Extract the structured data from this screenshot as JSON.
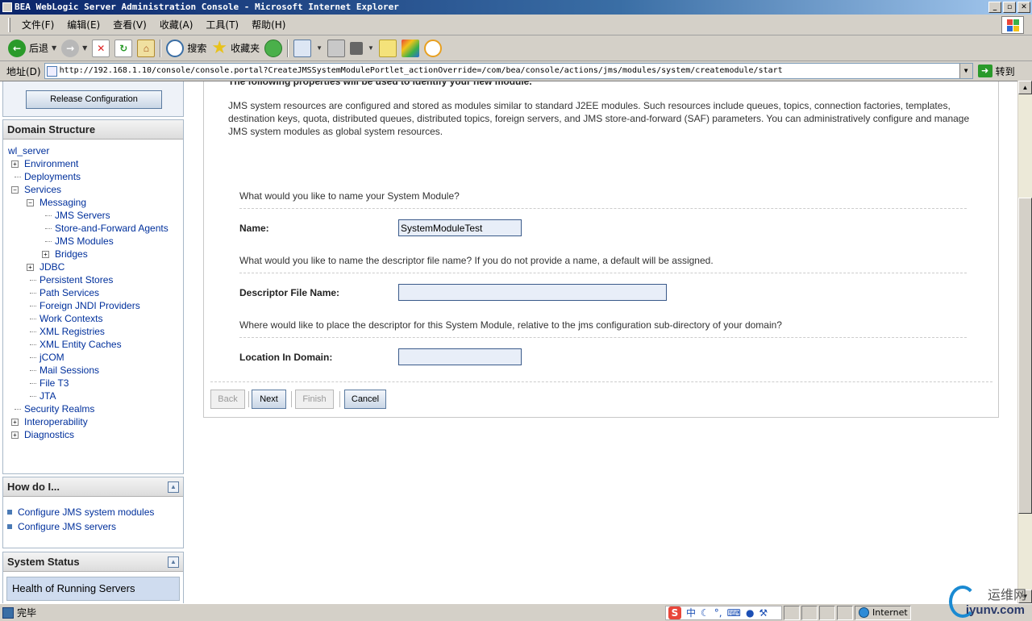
{
  "window": {
    "title": "BEA WebLogic Server Administration Console - Microsoft Internet Explorer",
    "buttons": [
      "_",
      "▫",
      "✕"
    ]
  },
  "menu": [
    "文件(F)",
    "编辑(E)",
    "查看(V)",
    "收藏(A)",
    "工具(T)",
    "帮助(H)"
  ],
  "toolbar": {
    "back": "后退",
    "search": "搜索",
    "favorites": "收藏夹"
  },
  "address": {
    "label": "地址(D)",
    "url": "http://192.168.1.10/console/console.portal?CreateJMSSystemModulePortlet_actionOverride=/com/bea/console/actions/jms/modules/system/createmodule/start",
    "go": "转到"
  },
  "sidebar": {
    "release_button": "Release Configuration",
    "domain_structure": {
      "title": "Domain Structure",
      "items": [
        {
          "label": "wl_server",
          "level": 0,
          "expander": "none"
        },
        {
          "label": "Environment",
          "level": 1,
          "expander": "plus"
        },
        {
          "label": "Deployments",
          "level": 1,
          "expander": "none"
        },
        {
          "label": "Services",
          "level": 1,
          "expander": "minus"
        },
        {
          "label": "Messaging",
          "level": 2,
          "expander": "minus"
        },
        {
          "label": "JMS Servers",
          "level": 3,
          "expander": "none"
        },
        {
          "label": "Store-and-Forward Agents",
          "level": 3,
          "expander": "none"
        },
        {
          "label": "JMS Modules",
          "level": 3,
          "expander": "none"
        },
        {
          "label": "Bridges",
          "level": 3,
          "expander": "plus"
        },
        {
          "label": "JDBC",
          "level": 2,
          "expander": "plus"
        },
        {
          "label": "Persistent Stores",
          "level": 2,
          "expander": "none"
        },
        {
          "label": "Path Services",
          "level": 2,
          "expander": "none"
        },
        {
          "label": "Foreign JNDI Providers",
          "level": 2,
          "expander": "none"
        },
        {
          "label": "Work Contexts",
          "level": 2,
          "expander": "none"
        },
        {
          "label": "XML Registries",
          "level": 2,
          "expander": "none"
        },
        {
          "label": "XML Entity Caches",
          "level": 2,
          "expander": "none"
        },
        {
          "label": "jCOM",
          "level": 2,
          "expander": "none"
        },
        {
          "label": "Mail Sessions",
          "level": 2,
          "expander": "none"
        },
        {
          "label": "File T3",
          "level": 2,
          "expander": "none"
        },
        {
          "label": "JTA",
          "level": 2,
          "expander": "none"
        },
        {
          "label": "Security Realms",
          "level": 1,
          "expander": "none"
        },
        {
          "label": "Interoperability",
          "level": 1,
          "expander": "plus"
        },
        {
          "label": "Diagnostics",
          "level": 1,
          "expander": "plus"
        }
      ]
    },
    "how_do_i": {
      "title": "How do I...",
      "links": [
        "Configure JMS system modules",
        "Configure JMS servers"
      ]
    },
    "system_status": {
      "title": "System Status",
      "health": "Health of Running Servers"
    }
  },
  "main": {
    "intro_title": "The following properties will be used to identify your new module.",
    "intro_text": "JMS system resources are configured and stored as modules similar to standard J2EE modules. Such resources include queues, topics, connection factories, templates, destination keys, quota, distributed queues, distributed topics, foreign servers, and JMS store-and-forward (SAF) parameters. You can administratively configure and manage JMS system modules as global system resources.",
    "q_name": "What would you like to name your System Module?",
    "name_label": "Name:",
    "name_value": "SystemModuleTest",
    "q_descriptor": "What would you like to name the descriptor file name? If you do not provide a name, a default will be assigned.",
    "descriptor_label": "Descriptor File Name:",
    "descriptor_value": "",
    "q_location": "Where would like to place the descriptor for this System Module, relative to the jms configuration sub-directory of your domain?",
    "location_label": "Location In Domain:",
    "location_value": "",
    "buttons": {
      "back": "Back",
      "next": "Next",
      "finish": "Finish",
      "cancel": "Cancel"
    }
  },
  "status": {
    "text": "完毕",
    "zone": "Internet",
    "ime": "中"
  },
  "watermark": {
    "cn": "运维网",
    "domain": "iyunv.com"
  }
}
